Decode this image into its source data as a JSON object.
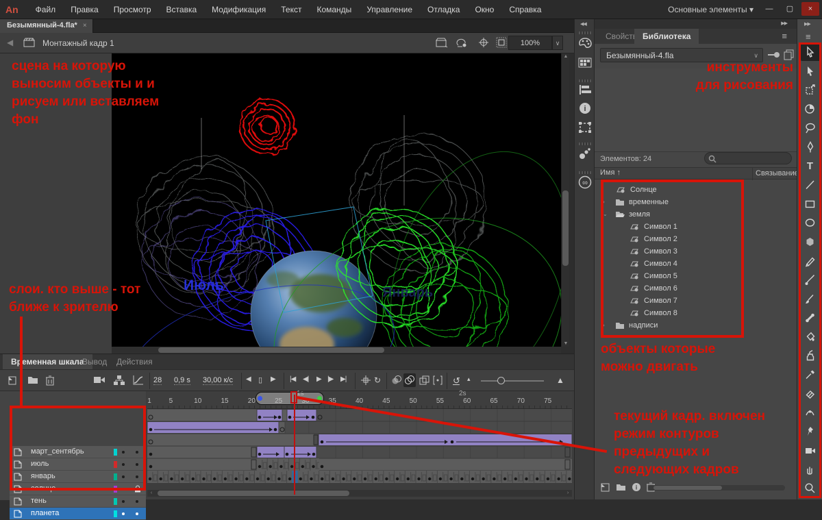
{
  "window": {
    "logo": "An",
    "menus": [
      "Файл",
      "Правка",
      "Просмотр",
      "Вставка",
      "Модификация",
      "Текст",
      "Команды",
      "Управление",
      "Отладка",
      "Окно",
      "Справка"
    ],
    "workspace": "Основные элементы",
    "doc_tab": "Безымянный-4.fla*",
    "minimize": "—",
    "maximize": "▢",
    "close": "×"
  },
  "edit_bar": {
    "scene": "Монтажный кадр 1",
    "zoom": "100%"
  },
  "stage": {
    "july_label": "Июль",
    "january_label": "Январь"
  },
  "icons": {
    "dropdown": "▾",
    "chevron": "∨",
    "burger": "≡",
    "tab_close": "×",
    "back": "◀",
    "collapse_l": "◀◀",
    "collapse_r": "▶▶",
    "up": "▲",
    "down": "▼",
    "left": "◄",
    "right": "►",
    "sb_left": "‹",
    "sb_right": "›",
    "step_back": "◀",
    "frame_box": "▯",
    "step_fwd": "▶",
    "go_first": "|◀",
    "prev": "◀|",
    "play": "▶",
    "next": "|▶",
    "go_last": "▶|",
    "loop": "↻",
    "reset": "↺",
    "tri_small": "▴",
    "tri_big": "▲",
    "col_outline": "П"
  },
  "library": {
    "tabs": [
      "Свойства",
      "Библиотека"
    ],
    "document": "Безымянный-4.fla",
    "count": "Элементов: 24",
    "col_name": "Имя ↑",
    "col_link": "Связывание",
    "items": [
      {
        "name": "Солнце"
      },
      {
        "name": "временные"
      },
      {
        "name": "земля"
      },
      {
        "name": "Символ 1"
      },
      {
        "name": "Символ 2"
      },
      {
        "name": "Символ 3"
      },
      {
        "name": "Символ 4"
      },
      {
        "name": "Символ 5"
      },
      {
        "name": "Символ 6"
      },
      {
        "name": "Символ 7"
      },
      {
        "name": "Символ 8"
      },
      {
        "name": "надписи"
      }
    ]
  },
  "timeline": {
    "tabs": [
      "Временная шкала",
      "Вывод",
      "Действия"
    ],
    "current_frame": "28",
    "elapsed_time": "0,9 s",
    "frame_rate": "30,00 к/с",
    "ruler": [
      "1",
      "5",
      "10",
      "15",
      "20",
      "25",
      "30",
      "35",
      "40",
      "45",
      "50",
      "55",
      "60",
      "65",
      "70",
      "75"
    ],
    "time_marks": [
      "1s",
      "2s"
    ],
    "layers": [
      {
        "name": "март_сентябрь",
        "color": "#00d2d2"
      },
      {
        "name": "июль",
        "color": "#d22a2a"
      },
      {
        "name": "январь",
        "color": "#00b08e"
      },
      {
        "name": "солнце",
        "color": "#a43bd4"
      },
      {
        "name": "тень",
        "color": "#00c8b4"
      },
      {
        "name": "планета",
        "color": "#00e0e0"
      }
    ]
  },
  "annotations": {
    "color": "#d81408",
    "scene": [
      "сцена на которую",
      "выносим объекты и и",
      "рисуем или вставляем",
      "фон"
    ],
    "layers": [
      "слои. кто выше - тот",
      "ближе к зрителю"
    ],
    "tools": [
      "инструменты",
      "для рисования"
    ],
    "library": [
      "объекты которые",
      "можно двигать"
    ],
    "frame": [
      "текущий кадр. включен",
      "режим контуров",
      "предыдущих и",
      "следующих кадров"
    ]
  }
}
